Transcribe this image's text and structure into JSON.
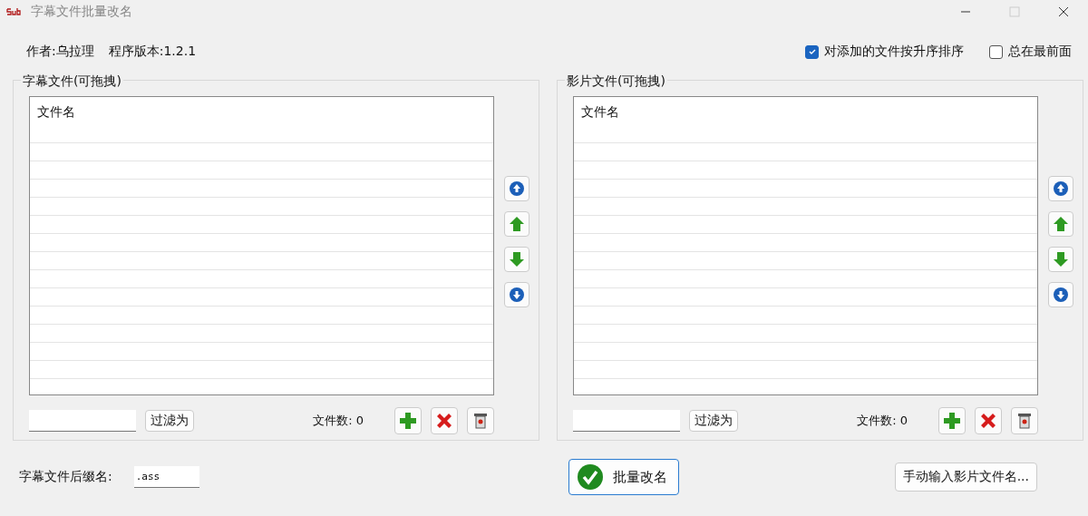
{
  "window": {
    "title": "字幕文件批量改名"
  },
  "info": {
    "author": "作者:乌拉理",
    "version": "程序版本:1.2.1"
  },
  "options": [
    {
      "label": "对添加的文件按升序排序",
      "checked": true
    },
    {
      "label": "总在最前面",
      "checked": false
    }
  ],
  "panels": [
    {
      "title": "字幕文件(可拖拽)",
      "column": "文件名",
      "filter_button": "过滤为",
      "count": "文件数: 0"
    },
    {
      "title": "影片文件(可拖拽)",
      "column": "文件名",
      "filter_button": "过滤为",
      "count": "文件数: 0"
    }
  ],
  "suffix": {
    "label": "字幕文件后缀名:",
    "value": ".ass"
  },
  "rename_button": "批量改名",
  "manual_button": "手动输入影片文件名..."
}
